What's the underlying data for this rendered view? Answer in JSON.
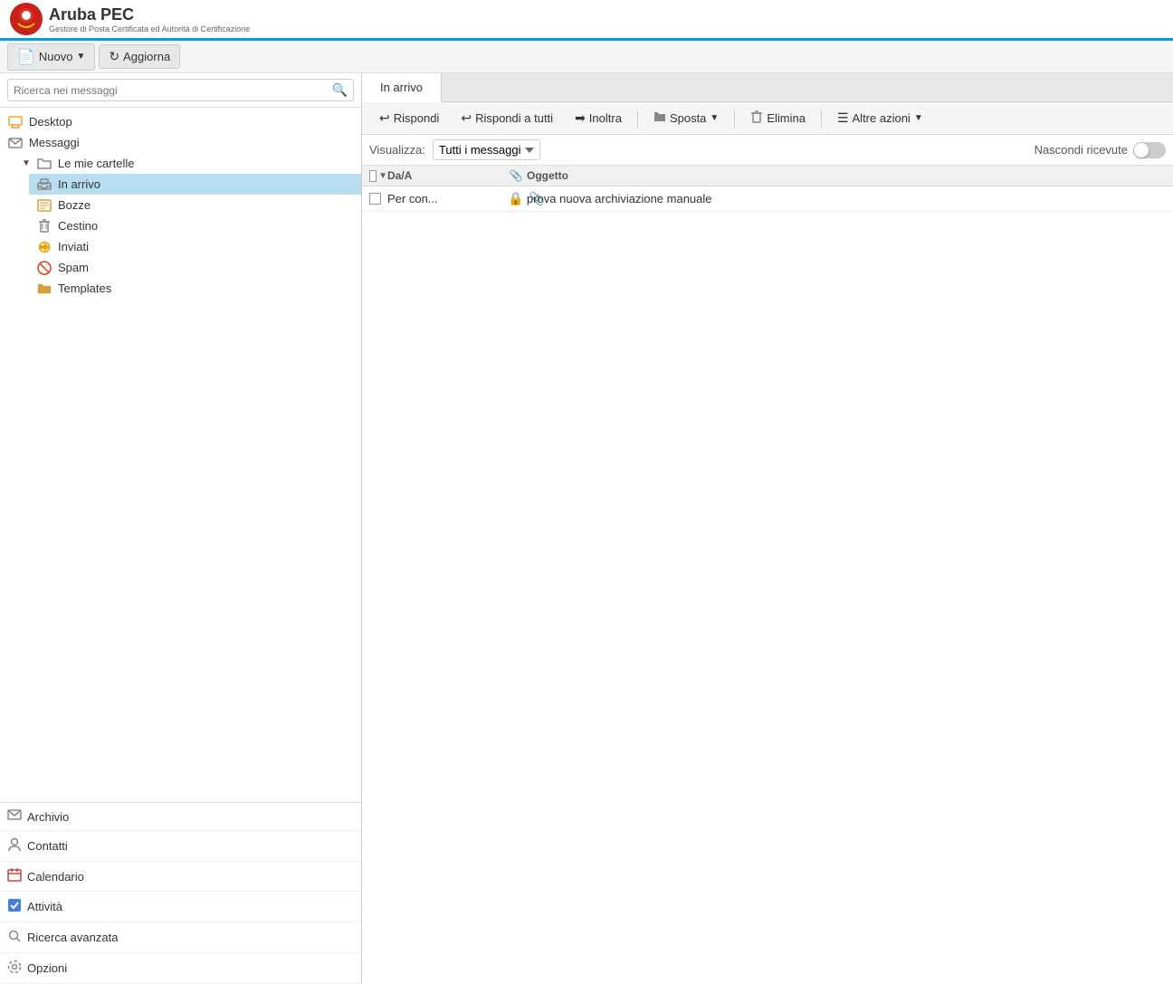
{
  "header": {
    "brand": "Aruba PEC",
    "subtitle": "Gestore di Posta Certificata ed Autorità di Certificazione"
  },
  "toolbar": {
    "new_label": "Nuovo",
    "refresh_label": "Aggiorna"
  },
  "sidebar": {
    "search_placeholder": "Ricerca nei messaggi",
    "items": [
      {
        "id": "desktop",
        "label": "Desktop",
        "icon": "desktop",
        "indent": 0
      },
      {
        "id": "messaggi",
        "label": "Messaggi",
        "icon": "mail",
        "indent": 0
      },
      {
        "id": "le-mie-cartelle",
        "label": "Le mie cartelle",
        "icon": "folder-open",
        "indent": 1,
        "chevron": true
      },
      {
        "id": "in-arrivo",
        "label": "In arrivo",
        "icon": "inbox",
        "indent": 2,
        "active": true
      },
      {
        "id": "bozze",
        "label": "Bozze",
        "icon": "drafts",
        "indent": 2
      },
      {
        "id": "cestino",
        "label": "Cestino",
        "icon": "trash",
        "indent": 2
      },
      {
        "id": "inviati",
        "label": "Inviati",
        "icon": "sent",
        "indent": 2
      },
      {
        "id": "spam",
        "label": "Spam",
        "icon": "spam",
        "indent": 2
      },
      {
        "id": "templates",
        "label": "Templates",
        "icon": "templates",
        "indent": 2
      }
    ],
    "bottom_items": [
      {
        "id": "archivio",
        "label": "Archivio",
        "icon": "mail"
      },
      {
        "id": "contatti",
        "label": "Contatti",
        "icon": "contacts"
      },
      {
        "id": "calendario",
        "label": "Calendario",
        "icon": "calendar"
      },
      {
        "id": "attivita",
        "label": "Attività",
        "icon": "tasks"
      },
      {
        "id": "ricerca-avanzata",
        "label": "Ricerca avanzata",
        "icon": "search"
      },
      {
        "id": "opzioni",
        "label": "Opzioni",
        "icon": "settings"
      }
    ]
  },
  "content": {
    "tabs": [
      {
        "id": "in-arrivo",
        "label": "In arrivo",
        "active": true
      }
    ],
    "actions": {
      "reply": "Rispondi",
      "reply_all": "Rispondi a tutti",
      "forward": "Inoltra",
      "move": "Sposta",
      "delete": "Elimina",
      "more": "Altre azioni"
    },
    "filter": {
      "label": "Visualizza:",
      "option": "Tutti i messaggi",
      "hide_received_label": "Nascondi ricevute"
    },
    "message_list": {
      "columns": {
        "from": "Da/A",
        "subject": "Oggetto"
      },
      "messages": [
        {
          "sender": "Per con...",
          "has_lock": true,
          "has_attach": true,
          "subject": "prova nuova archiviazione manuale"
        }
      ]
    }
  },
  "icons": {
    "search": "🔍",
    "desktop": "🖥",
    "mail": "✉",
    "folder": "📁",
    "inbox": "📥",
    "drafts": "📋",
    "trash": "🗑",
    "sent": "📤",
    "spam": "⚠",
    "templates": "📁",
    "contacts": "👤",
    "calendar": "📅",
    "tasks": "✔",
    "settings": "⚙",
    "archive": "🗃",
    "reply": "↩",
    "forward": "➡",
    "move": "📁",
    "delete": "🗑",
    "more": "☰",
    "lock": "🔒",
    "attach": "📎",
    "chevron_down": "▼",
    "chevron_right": "▶",
    "refresh": "↻"
  }
}
